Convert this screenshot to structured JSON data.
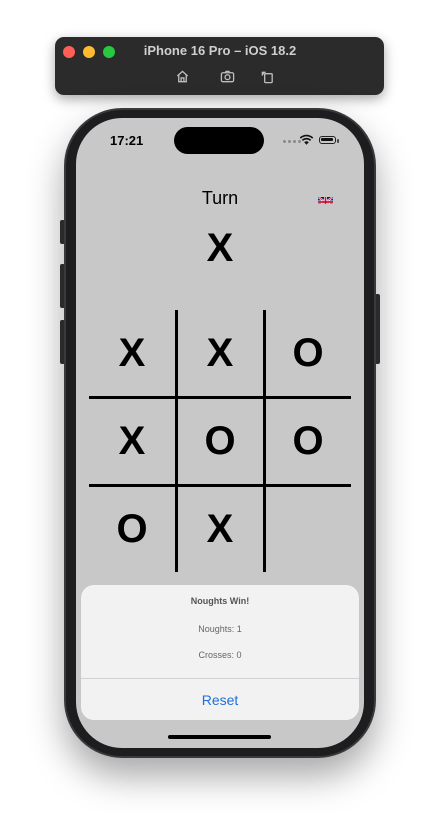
{
  "simulator": {
    "title": "iPhone 16 Pro – iOS 18.2",
    "buttons": [
      "home-icon",
      "screenshot-icon",
      "rotate-icon"
    ]
  },
  "status_bar": {
    "time": "17:21"
  },
  "game": {
    "turn_label": "Turn",
    "current_player": "X",
    "language_flag": "uk-flag-icon",
    "board": [
      "X",
      "X",
      "O",
      "X",
      "O",
      "O",
      "O",
      "X",
      ""
    ]
  },
  "alert": {
    "title": "Noughts Win!",
    "noughts_score": "Noughts: 1",
    "crosses_score": "Crosses: 0",
    "action_label": "Reset",
    "action_color": "#1e6fd9"
  },
  "colors": {
    "screen_background": "#c8c8c8",
    "toolbar_background": "#2b2b2c"
  }
}
